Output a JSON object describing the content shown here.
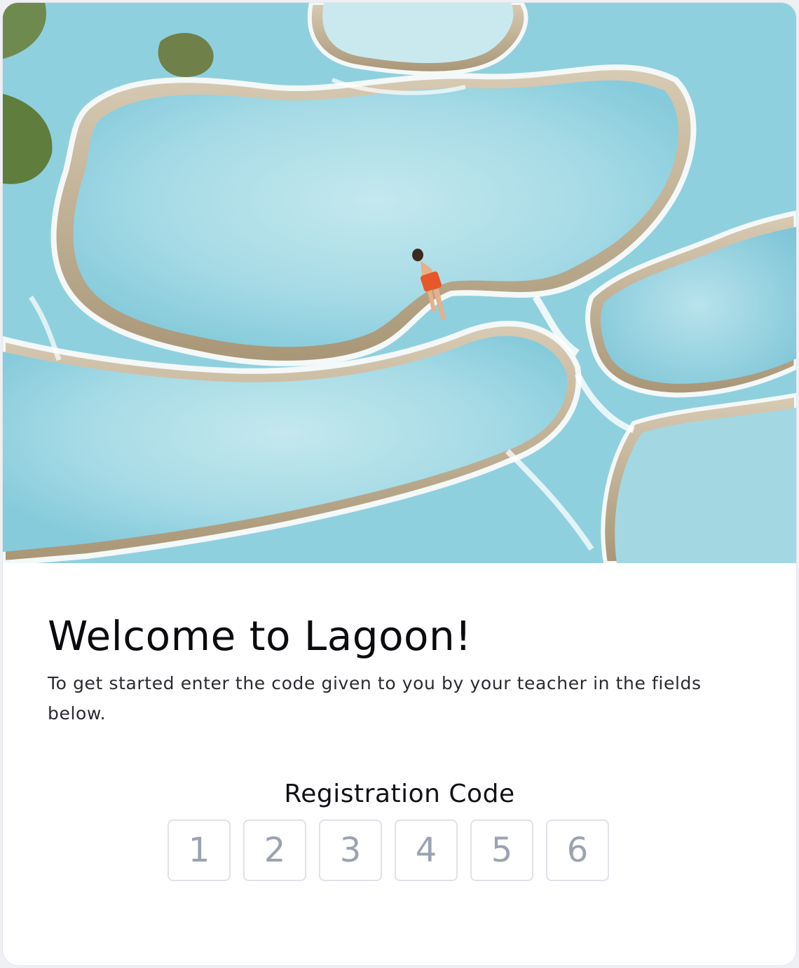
{
  "hero": {
    "image_subject": "aerial view of turquoise thermal pools with a person lying at the edge"
  },
  "welcome": {
    "title": "Welcome to Lagoon!",
    "subtitle": "To get started enter the code given to you by your teacher in the fields below."
  },
  "registration": {
    "label": "Registration Code",
    "fields": [
      {
        "placeholder": "1",
        "value": ""
      },
      {
        "placeholder": "2",
        "value": ""
      },
      {
        "placeholder": "3",
        "value": ""
      },
      {
        "placeholder": "4",
        "value": ""
      },
      {
        "placeholder": "5",
        "value": ""
      },
      {
        "placeholder": "6",
        "value": ""
      }
    ]
  },
  "colors": {
    "water": "#9ed6e2",
    "placeholder_text": "#9ba3b2",
    "field_border": "#dfe2e7",
    "title_text": "#0b0b0f"
  }
}
